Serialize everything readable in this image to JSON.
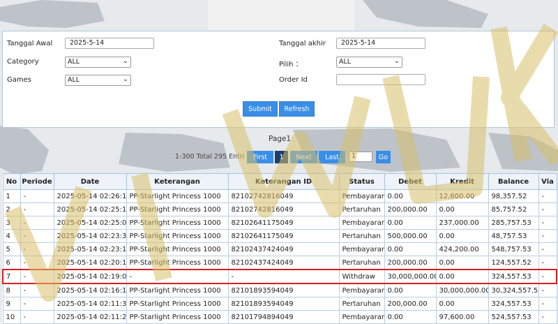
{
  "filters": {
    "tanggal_awal_label": "Tanggal Awal",
    "tanggal_awal_value": "2025-5-14",
    "tanggal_akhir_label": "Tanggal akhir",
    "tanggal_akhir_value": "2025-5-14",
    "category_label": "Category",
    "category_value": "ALL",
    "pilih_label": "Pilih ：",
    "pilih_value": "ALL",
    "games_label": "Games",
    "games_value": "ALL",
    "order_id_label": "Order Id",
    "order_id_value": "",
    "submit_label": "Submit",
    "refresh_label": "Refresh"
  },
  "pager": {
    "title": "Page1",
    "info": "1-300 Total 295 Entri",
    "first_label": "First",
    "current_page": "1",
    "next_label": "Next",
    "last_label": "Last",
    "goto_value": "1",
    "go_label": "Go"
  },
  "table": {
    "headers": [
      "No",
      "Periode",
      "Date",
      "Keterangan",
      "Keterangan ID",
      "Status",
      "Debet",
      "Kredit",
      "Balance",
      "Via"
    ],
    "rows": [
      [
        "1",
        "-",
        "2025-05-14 02:26:19",
        "PP-Starlight Princess 1000",
        "82102742816049",
        "Pembayaran",
        "0.00",
        "12,600.00",
        "98,357.52",
        "-"
      ],
      [
        "2",
        "-",
        "2025-05-14 02:25:15",
        "PP-Starlight Princess 1000",
        "82102742816049",
        "Pertaruhan",
        "200,000.00",
        "0.00",
        "85,757.52",
        "-"
      ],
      [
        "3",
        "-",
        "2025-05-14 02:25:07",
        "PP-Starlight Princess 1000",
        "82102641175049",
        "Pembayaran",
        "0.00",
        "237,000.00",
        "285,757.53",
        "-"
      ],
      [
        "4",
        "-",
        "2025-05-14 02:23:34",
        "PP-Starlight Princess 1000",
        "82102641175049",
        "Pertaruhan",
        "500,000.00",
        "0.00",
        "48,757.53",
        "-"
      ],
      [
        "5",
        "-",
        "2025-05-14 02:23:14",
        "PP-Starlight Princess 1000",
        "82102437424049",
        "Pembayaran",
        "0.00",
        "424,200.00",
        "548,757.53",
        "-"
      ],
      [
        "6",
        "-",
        "2025-05-14 02:20:10",
        "PP-Starlight Princess 1000",
        "82102437424049",
        "Pertaruhan",
        "200,000.00",
        "0.00",
        "124,557.52",
        "-"
      ],
      [
        "7",
        "-",
        "2025-05-14 02:19:02",
        "-",
        "-",
        "Withdraw",
        "30,000,000.00",
        "0.00",
        "324,557.53",
        "-"
      ],
      [
        "8",
        "-",
        "2025-05-14 02:16:14",
        "PP-Starlight Princess 1000",
        "82101893594049",
        "Pembayaran",
        "0.00",
        "30,000,000.00",
        "30,324,557.52",
        "-"
      ],
      [
        "9",
        "-",
        "2025-05-14 02:11:34",
        "PP-Starlight Princess 1000",
        "82101893594049",
        "Pertaruhan",
        "200,000.00",
        "0.00",
        "324,557.53",
        "-"
      ],
      [
        "10",
        "-",
        "2025-05-14 02:11:26",
        "PP-Starlight Princess 1000",
        "82101794894049",
        "Pembayaran",
        "0.00",
        "97,600.00",
        "524,557.53",
        "-"
      ]
    ],
    "highlighted_row_index": 6
  },
  "watermark": {
    "text": "VIWK",
    "color": "#d8c06a"
  },
  "colors": {
    "accent": "#3a8ee6",
    "highlight": "#d61f1f",
    "link": "#2a7ab8"
  }
}
